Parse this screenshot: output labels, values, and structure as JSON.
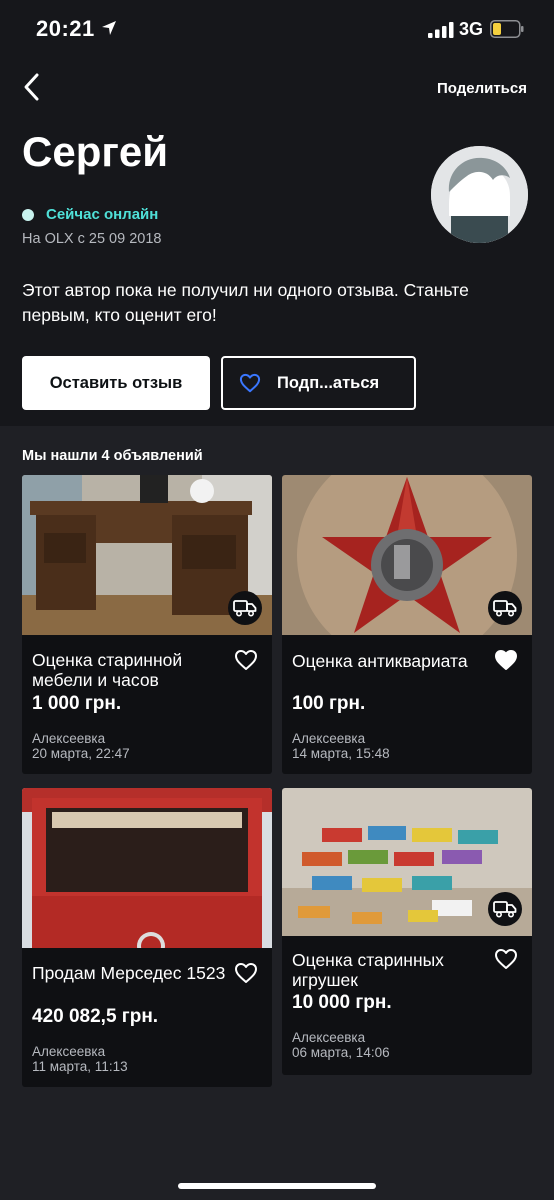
{
  "status_bar": {
    "time": "20:21",
    "network": "3G"
  },
  "header": {
    "share_label": "Поделиться"
  },
  "profile": {
    "name": "Сергей",
    "online_status": "Сейчас онлайн",
    "member_since": "На OLX с 25 09 2018",
    "reviews_text": "Этот автор пока не получил ни одного отзыва. Станьте первым, кто оценит его!"
  },
  "actions": {
    "leave_review": "Оставить отзыв",
    "subscribe": "Подп...аться"
  },
  "listings_header": "Мы нашли 4 объявлений",
  "listings": [
    {
      "title": "Оценка старинной мебели и часов",
      "price": "1 000 грн.",
      "location": "Алексеевка",
      "date": "20 марта, 22:47",
      "favorited": false,
      "delivery": true
    },
    {
      "title": "Оценка антиквариата",
      "price": "100 грн.",
      "location": "Алексеевка",
      "date": "14 марта, 15:48",
      "favorited": true,
      "delivery": true
    },
    {
      "title": "Продам Мерседес 1523",
      "price": "420 082,5 грн.",
      "location": "Алексеевка",
      "date": "11 марта, 11:13",
      "favorited": false,
      "delivery": false
    },
    {
      "title": "Оценка старинных игрушек",
      "price": "10 000 грн.",
      "location": "Алексеевка",
      "date": "06 марта, 14:06",
      "favorited": false,
      "delivery": true
    }
  ],
  "icons": {
    "back": "chevron-left-icon",
    "heart_outline": "heart-outline-icon",
    "heart_filled": "heart-filled-icon",
    "delivery": "delivery-truck-icon"
  },
  "colors": {
    "background": "#16171b",
    "listing_area": "#1f2025",
    "card": "#0f1013",
    "online_accent": "#4fe0d8",
    "subscribe_heart": "#3a77ff"
  }
}
